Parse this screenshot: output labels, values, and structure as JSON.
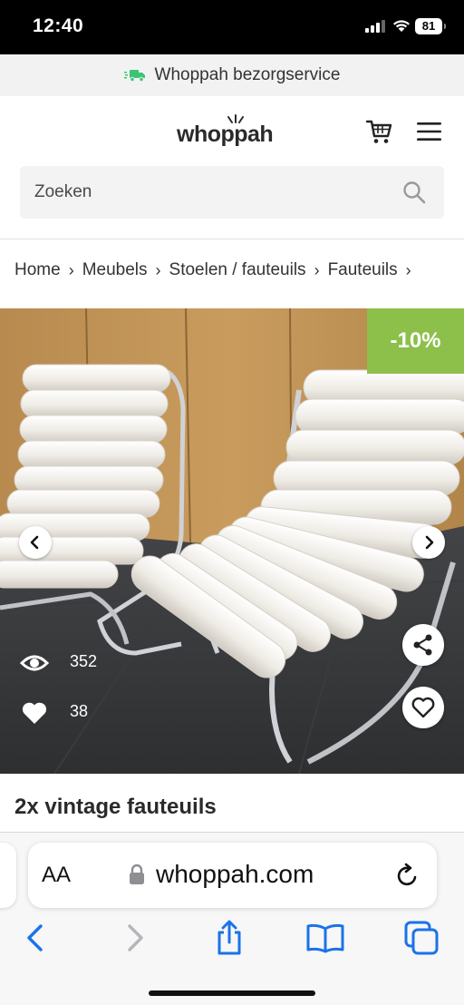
{
  "status_bar": {
    "time": "12:40",
    "battery": "81"
  },
  "delivery_banner": {
    "text": "Whoppah bezorgservice",
    "icon": "truck-icon"
  },
  "header": {
    "logo": "whoppah",
    "cart_icon": "cart-icon",
    "menu_icon": "menu-icon"
  },
  "search": {
    "placeholder": "Zoeken",
    "value": ""
  },
  "breadcrumb": [
    {
      "label": "Home"
    },
    {
      "label": "Meubels"
    },
    {
      "label": "Stoelen / fauteuils"
    },
    {
      "label": "Fauteuils"
    }
  ],
  "product": {
    "discount": "-10%",
    "views": "352",
    "likes": "38",
    "title": "2x vintage fauteuils",
    "colors": {
      "discount_badge": "#8cc04a",
      "chair_upholstery": "#f0ede6"
    }
  },
  "safari": {
    "text_size_label": "AA",
    "address": "whoppah.com"
  }
}
